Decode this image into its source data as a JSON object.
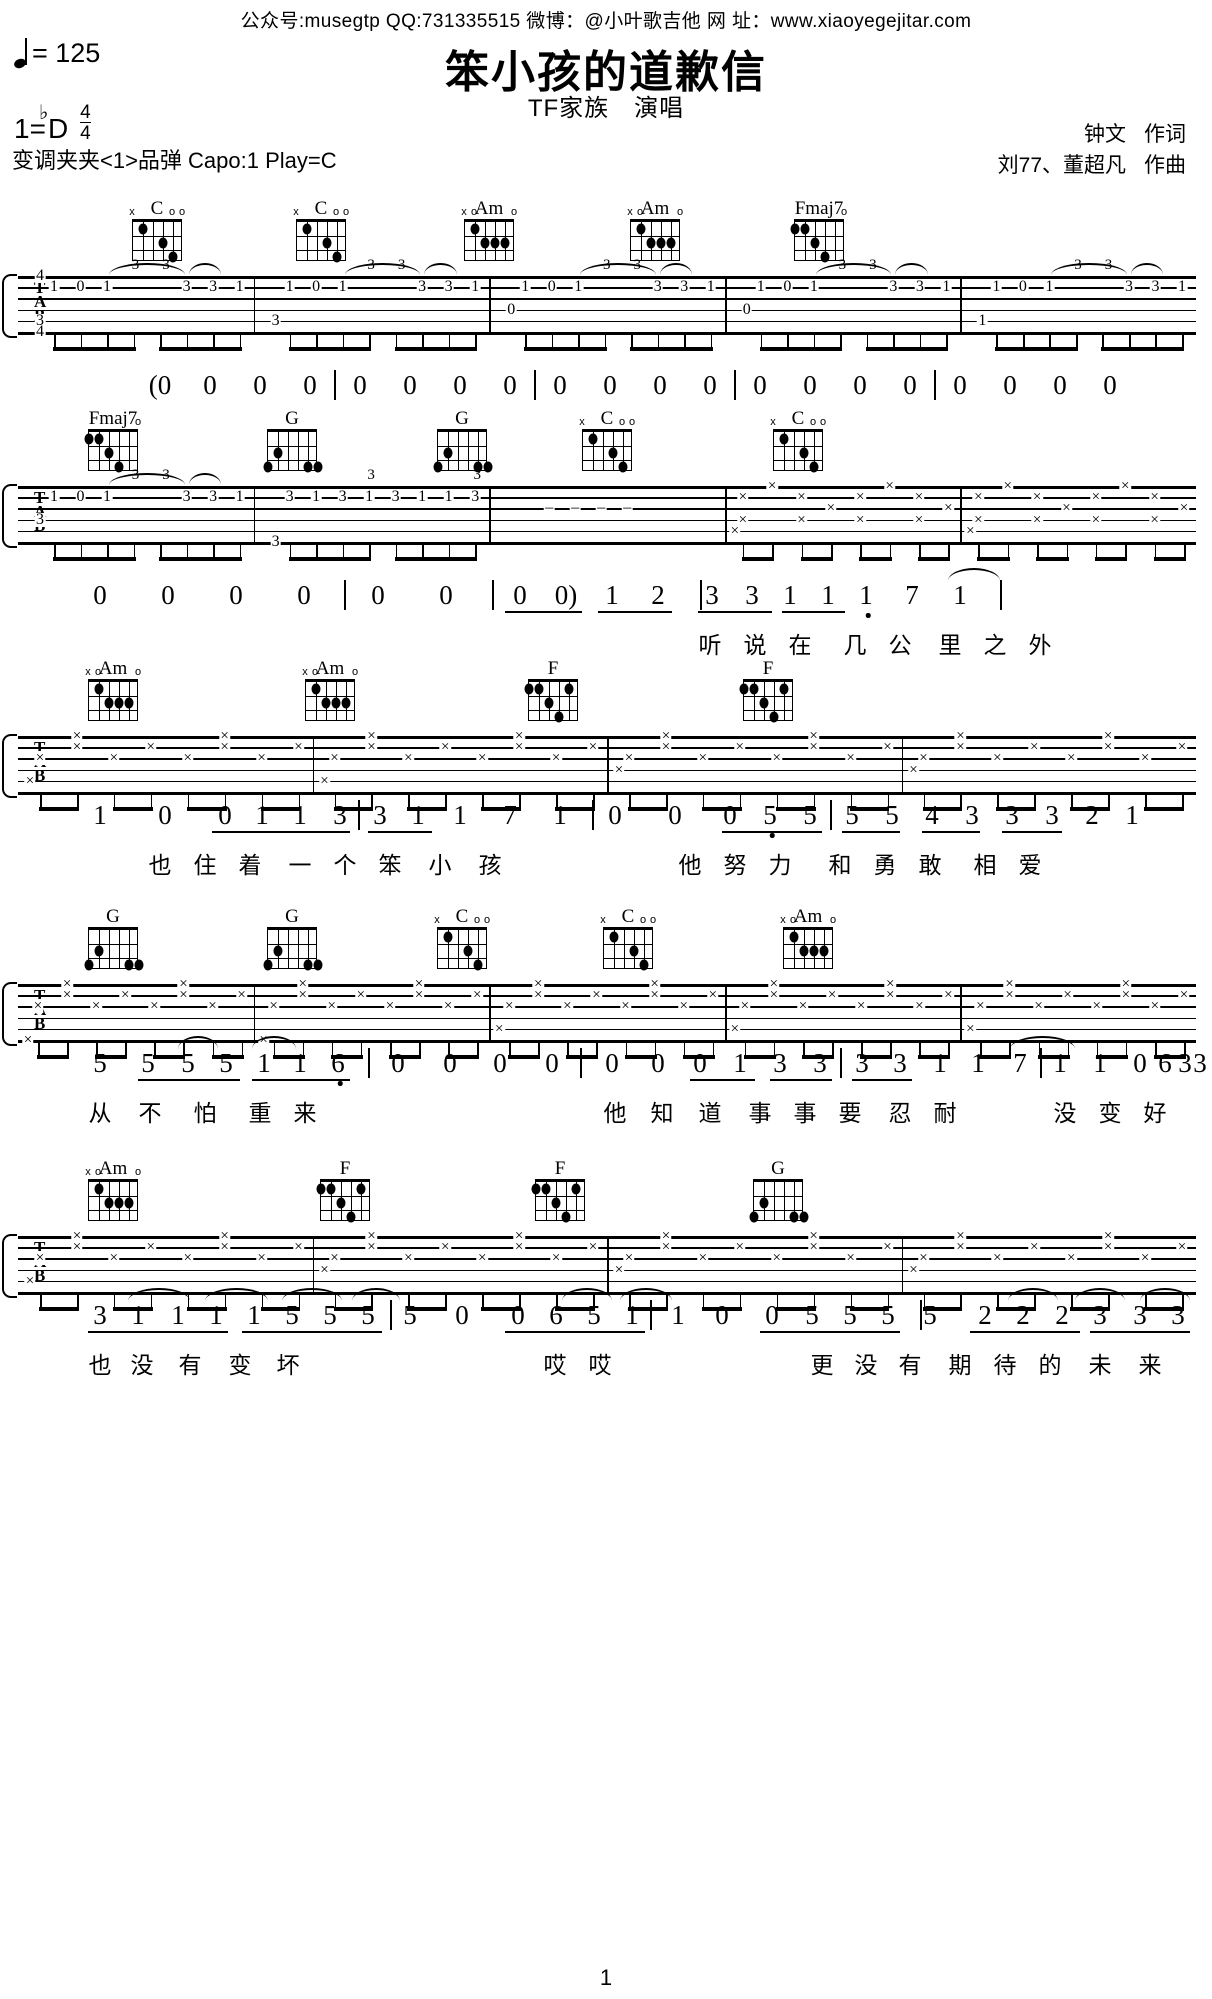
{
  "header": {
    "site_line": "公众号:musegtp   QQ:731335515   微博：@小叶歌吉他  网 址：www.xiaoyegejitar.com",
    "tempo_label": "= 125",
    "title": "笨小孩的道歉信",
    "subtitle": "TF家族　演唱",
    "key_prefix": "1=",
    "key_flat": "♭",
    "key_note": "D",
    "meter_num": "4",
    "meter_den": "4",
    "capo_line": "变调夹夹<1>品弹  Capo:1  Play=C",
    "lyricist": "钟文",
    "lyricist_role": "作词",
    "composer": "刘77、董超凡",
    "composer_role": "作曲",
    "page_number": "1"
  },
  "systems": [
    {
      "chords": [
        "C",
        "C",
        "Am",
        "Am",
        "Fmaj7"
      ],
      "jianpu": [
        "(0",
        "0",
        "0",
        "0",
        "0",
        "0",
        "0",
        "0",
        "0",
        "0",
        "0",
        "0",
        "0",
        "0",
        "0",
        "0",
        "0",
        "0",
        "0",
        "0"
      ],
      "lyrics": []
    },
    {
      "chords": [
        "Fmaj7",
        "G",
        "G",
        "C",
        "C"
      ],
      "jianpu": [
        "0",
        "0",
        "0",
        "0",
        "0",
        "0",
        "0",
        "0",
        "0",
        "0",
        "0",
        "0",
        "0",
        "0",
        "0)",
        "1",
        "2",
        "3",
        "3",
        "1",
        "1",
        "1",
        "7",
        "1"
      ],
      "lyrics": [
        "听",
        "说",
        "在",
        "几",
        "公",
        "里",
        "之",
        "外"
      ]
    },
    {
      "chords": [
        "Am",
        "Am",
        "F",
        "F"
      ],
      "jianpu": [
        "1",
        "0",
        "0",
        "1",
        "1",
        "3",
        "3",
        "1",
        "1",
        "7",
        "1",
        "0",
        "0",
        "0",
        "5",
        "5",
        "5",
        "5",
        "4",
        "3",
        "3",
        "3",
        "2",
        "1"
      ],
      "lyrics": [
        "也",
        "住",
        "着",
        "一",
        "个",
        "笨",
        "小",
        "孩",
        "他",
        "努",
        "力",
        "和",
        "勇",
        "敢",
        "相",
        "爱"
      ]
    },
    {
      "chords": [
        "G",
        "G",
        "C",
        "C",
        "Am"
      ],
      "jianpu": [
        "5",
        "5",
        "5",
        "5",
        "1",
        "1",
        "6",
        "0",
        "0",
        "0",
        "0",
        "0",
        "0",
        "0",
        "1",
        "3",
        "3",
        "3",
        "3",
        "1",
        "1",
        "7",
        "1",
        "1",
        "0",
        "6",
        "3",
        "3"
      ],
      "lyrics": [
        "从",
        "不",
        "怕",
        "重",
        "来",
        "他",
        "知",
        "道",
        "事",
        "事",
        "要",
        "忍",
        "耐",
        "没",
        "变",
        "好"
      ]
    },
    {
      "chords": [
        "Am",
        "F",
        "F",
        "G"
      ],
      "jianpu": [
        "3",
        "1",
        "1",
        "1",
        "1",
        "5",
        "5",
        "5",
        "5",
        "0",
        "0",
        "6",
        "5",
        "1",
        "1",
        "0",
        "0",
        "5",
        "5",
        "5",
        "5",
        "2",
        "2",
        "2",
        "3",
        "3",
        "3"
      ],
      "lyrics": [
        "也",
        "没",
        "有",
        "变",
        "坏",
        "哎",
        "哎",
        "更",
        "没",
        "有",
        "期",
        "待",
        "的",
        "未",
        "来"
      ]
    }
  ],
  "chord_shapes": {
    "C": {
      "marks": [
        "x",
        "",
        "",
        "",
        "o",
        "o"
      ],
      "dots": [
        [
          5,
          1
        ],
        [
          3,
          2
        ],
        [
          2,
          3
        ]
      ]
    },
    "Am": {
      "marks": [
        "x",
        "o",
        "",
        "",
        "",
        "o"
      ],
      "dots": [
        [
          4,
          2
        ],
        [
          3,
          2
        ],
        [
          2,
          2
        ],
        [
          5,
          1
        ]
      ]
    },
    "Fmaj7": {
      "marks": [
        "",
        "",
        "",
        "",
        "",
        "o"
      ],
      "dots": [
        [
          6,
          1
        ],
        [
          5,
          1
        ],
        [
          4,
          2
        ],
        [
          3,
          3
        ]
      ]
    },
    "F": {
      "marks": [
        "",
        "",
        "",
        "",
        "",
        ""
      ],
      "dots": [
        [
          6,
          1
        ],
        [
          5,
          1
        ],
        [
          2,
          1
        ],
        [
          4,
          2
        ],
        [
          3,
          3
        ]
      ]
    },
    "G": {
      "marks": [
        "",
        "",
        "",
        "",
        "",
        ""
      ],
      "dots": [
        [
          6,
          3
        ],
        [
          5,
          2
        ],
        [
          1,
          3
        ],
        [
          2,
          3
        ]
      ]
    }
  },
  "tab": {
    "clef_letters": [
      "T",
      "A",
      "B"
    ],
    "system1_numbers": "1 0 1 3 3 1 | 1 0 1 3 3 1 | 1 0 1 3 3 1 | 1 0 1 3 3 1 | 1 0 1 3 3 1",
    "tuplet_label": "3"
  }
}
